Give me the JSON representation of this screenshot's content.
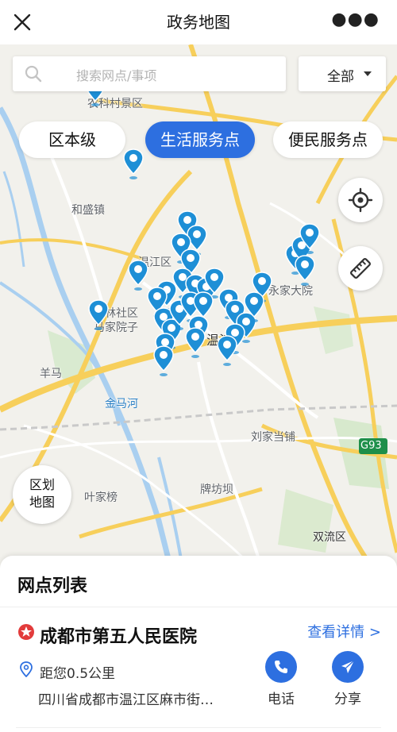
{
  "nav": {
    "title": "政务地图"
  },
  "search": {
    "placeholder": "搜索网点/事项"
  },
  "filter": {
    "label": "全部"
  },
  "tabs": [
    {
      "label": "区本级",
      "active": false
    },
    {
      "label": "生活服务点",
      "active": true
    },
    {
      "label": "便民服务点",
      "active": false
    }
  ],
  "map_labels": {
    "nongke": "农科村景区",
    "heshengzhen": "和盛镇",
    "wenjiangqu": "温江区",
    "yongjiadayuan": "永家大院",
    "shelinqu": "鲁林社区",
    "anjiayuanzi": "马家院子",
    "wenjiang": "温江",
    "yangma": "羊马",
    "jinmahe": "金马河",
    "liujiadangpu": "刘家当铺",
    "g93": "G93",
    "paifangba": "牌坊坝",
    "yejiabang": "叶家榜",
    "shuangliuqu": "双流区"
  },
  "district_map": {
    "line1": "区划",
    "line2": "地图"
  },
  "panel": {
    "title": "网点列表",
    "item": {
      "name": "成都市第五人民医院",
      "detail_link": "查看详情 >",
      "distance": "距您0.5公里",
      "address": "四川省成都市温江区麻市街…",
      "call_label": "电话",
      "share_label": "分享"
    }
  },
  "colors": {
    "accent": "#2d6fe0",
    "pin": "#1e8fd6",
    "road": "#f7cf5b",
    "river": "#a9cff0"
  }
}
